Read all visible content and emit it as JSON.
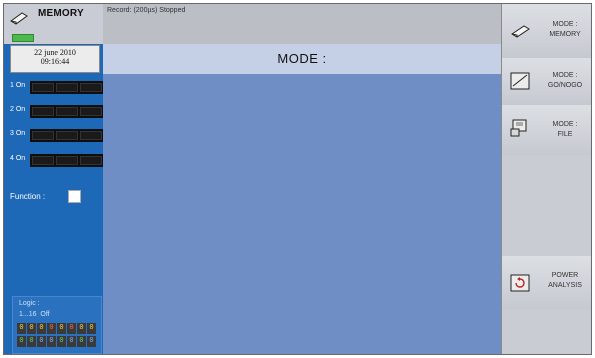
{
  "header": {
    "app_title": "MEMORY",
    "status": "Record: (200µs) Stopped"
  },
  "left_panel": {
    "date": "22 june 2010",
    "time": "09:16:44",
    "channels": [
      {
        "label": "1 On"
      },
      {
        "label": "2 On"
      },
      {
        "label": "3 On"
      },
      {
        "label": "4 On"
      }
    ],
    "function_label": "Function :",
    "logic": {
      "title": "Logic :",
      "range": "1...16",
      "state": "Off",
      "row1": [
        "0",
        "0",
        "0",
        "0",
        "0",
        "0",
        "0",
        "0"
      ],
      "row2": [
        "0",
        "0",
        "0",
        "0",
        "0",
        "0",
        "0",
        "0"
      ]
    }
  },
  "main": {
    "mode_title": "MODE :"
  },
  "menu": {
    "items": [
      {
        "line1": "MODE :",
        "line2": "MEMORY"
      },
      {
        "line1": "MODE :",
        "line2": "GO/NOGO"
      },
      {
        "line1": "MODE :",
        "line2": "FILE"
      },
      {
        "line1": "POWER",
        "line2": "ANALYSIS"
      }
    ]
  },
  "colors": {
    "panel_blue": "#1e68b8",
    "main_blue": "#6f8ec6",
    "battery": "#4db84d"
  }
}
